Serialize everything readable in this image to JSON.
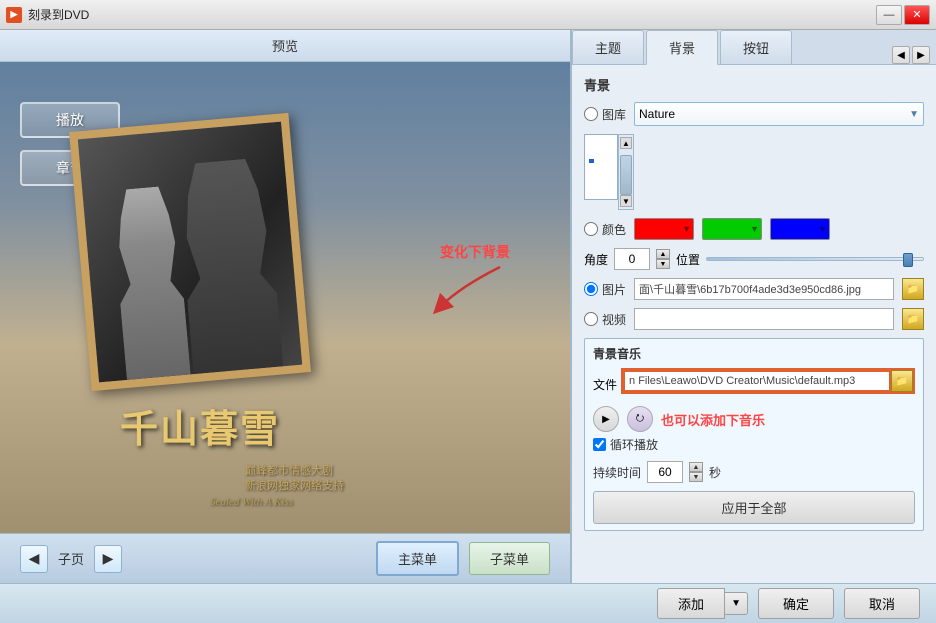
{
  "window": {
    "title": "刻录到DVD",
    "icon": "DVD",
    "minimize_label": "—",
    "close_label": "✕"
  },
  "left_panel": {
    "header": "预览",
    "preview": {
      "title": "千山暮雪",
      "subtitle1": "巅峰都市情感大剧",
      "subtitle2": "新浪网独家网络支持",
      "subtitle3": "Sealed With A Kiss",
      "btn_play": "播放",
      "btn_chapter": "章节",
      "annotation_text": "变化下背景"
    },
    "nav": {
      "prev_label": "◀",
      "next_label": "▶",
      "subpage_label": "子页",
      "main_menu_label": "主菜单",
      "sub_menu_label": "子菜单"
    }
  },
  "right_panel": {
    "tabs": [
      "主题",
      "背景",
      "按钮"
    ],
    "tab_nav_prev": "◀",
    "tab_nav_next": "▶",
    "content": {
      "section_label": "青景",
      "library_radio": "图库",
      "library_value": "Nature",
      "color_radio": "颜色",
      "image_radio": "图片",
      "video_radio": "视频",
      "angle_label": "角度",
      "angle_value": "0",
      "position_label": "位置",
      "image_path": "面\\千山暮雪\\6b17b700f4ade3d3e950cd86.jpg",
      "video_path": "",
      "music_section": {
        "label": "青景音乐",
        "file_label": "文件",
        "file_path": "n Files\\Leawo\\DVD Creator\\Music\\default.mp3",
        "annotation": "也可以添加下音乐",
        "loop_label": "循环播放",
        "duration_label": "持续时间",
        "duration_value": "60",
        "duration_unit": "秒",
        "apply_label": "应用于全部"
      },
      "thumbnails": [
        {
          "id": "sky",
          "style": "sky",
          "selected": false
        },
        {
          "id": "forest",
          "style": "forest",
          "selected": false
        },
        {
          "id": "field",
          "style": "field",
          "selected": false
        },
        {
          "id": "beach",
          "style": "beach",
          "selected": true
        },
        {
          "id": "water",
          "style": "water",
          "selected": false
        },
        {
          "id": "trees",
          "style": "trees",
          "selected": false
        },
        {
          "id": "blue",
          "style": "blue",
          "selected": false
        }
      ],
      "colors": {
        "color1": "#ff0000",
        "color2": "#00cc00",
        "color3": "#0000ff"
      }
    }
  },
  "bottom_bar": {
    "add_label": "添加",
    "confirm_label": "确定",
    "cancel_label": "取消"
  }
}
